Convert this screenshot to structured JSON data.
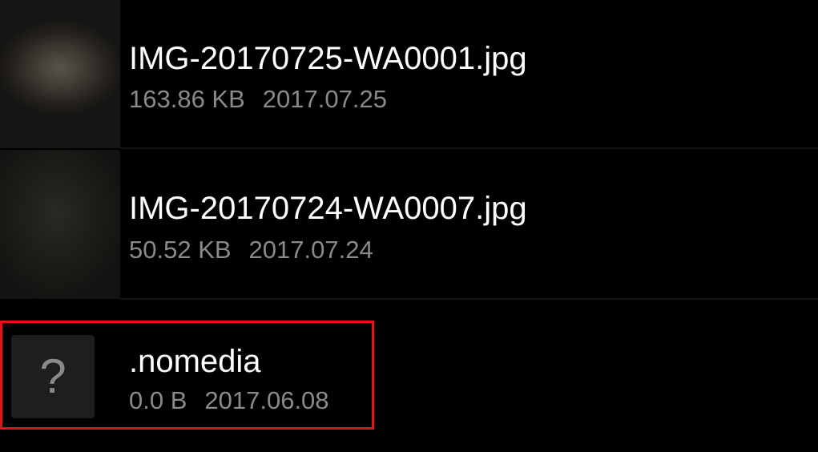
{
  "files": [
    {
      "name": "IMG-20170725-WA0001.jpg",
      "size": "163.86 KB",
      "date": "2017.07.25",
      "thumbnail": "photo-thumbnail"
    },
    {
      "name": "IMG-20170724-WA0007.jpg",
      "size": "50.52 KB",
      "date": "2017.07.24",
      "thumbnail": "photo-thumbnail"
    },
    {
      "name": ".nomedia",
      "size": "0.0 B",
      "date": "2017.06.08",
      "thumbnail": "unknown-file-icon",
      "icon_glyph": "?"
    }
  ],
  "highlight": {
    "target": ".nomedia",
    "color": "#e3101a"
  },
  "colors": {
    "background": "#000000",
    "name_text": "#ffffff",
    "meta_text": "#8a8a8a"
  }
}
